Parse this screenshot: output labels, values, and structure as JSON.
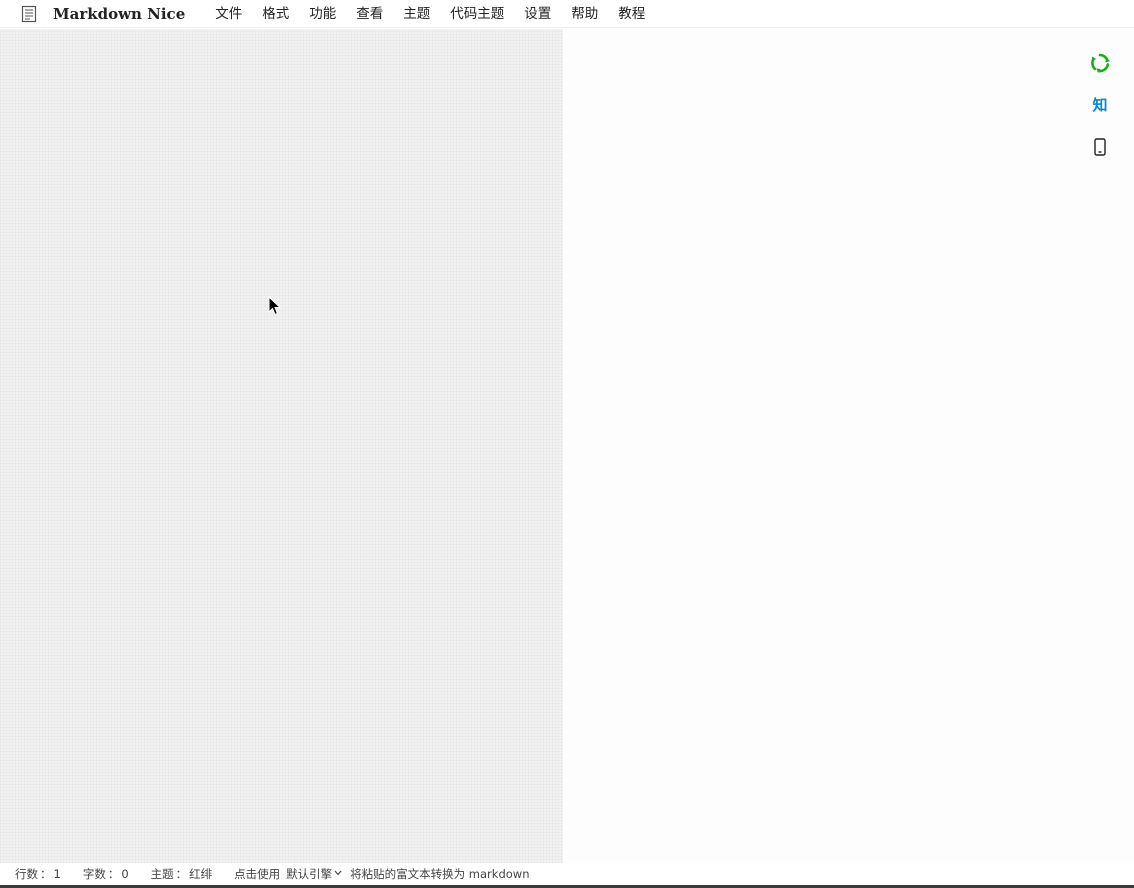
{
  "app": {
    "brand": "Markdown Nice"
  },
  "menu": {
    "items": [
      "文件",
      "格式",
      "功能",
      "查看",
      "主题",
      "代码主题",
      "设置",
      "帮助",
      "教程"
    ]
  },
  "side_tools": {
    "icons": [
      "wechat-icon",
      "zhihu-icon",
      "mobile-preview-icon"
    ],
    "zhihu_label": "知",
    "colors": {
      "wechat": "#1aad19",
      "zhihu": "#0a84d4"
    }
  },
  "status": {
    "lines_label": "行数",
    "lines_value": "1",
    "chars_label": "字数",
    "chars_value": "0",
    "theme_label": "主题",
    "theme_value": "红绯",
    "click_use": "点击使用",
    "engine_value": "默认引擎",
    "paste_hint": "将粘贴的富文本转换为 markdown",
    "separator": "："
  }
}
